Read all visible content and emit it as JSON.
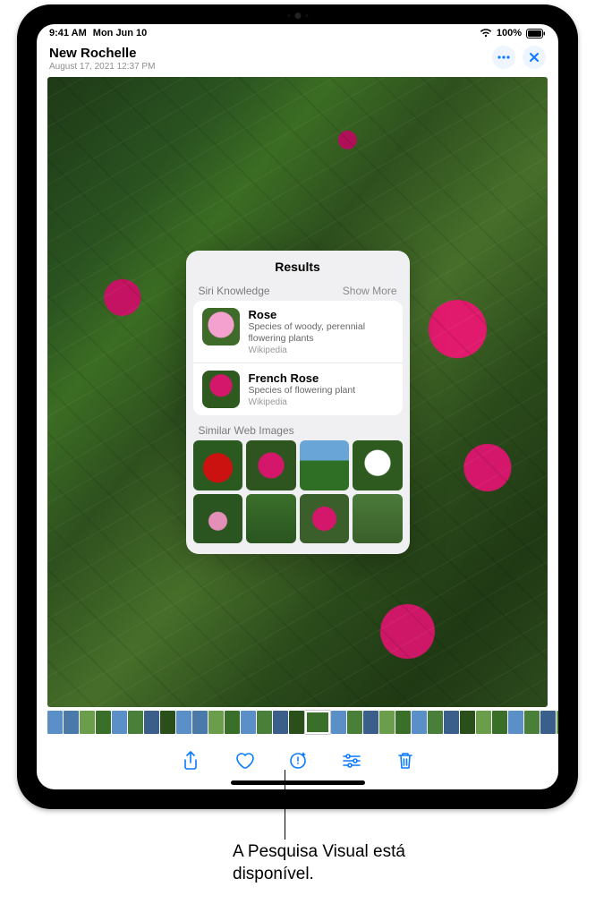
{
  "status": {
    "time": "9:41 AM",
    "date": "Mon Jun 10",
    "battery": "100%"
  },
  "header": {
    "location": "New Rochelle",
    "subtitle": "August 17, 2021  12:37 PM"
  },
  "popover": {
    "title": "Results",
    "siri_knowledge_label": "Siri Knowledge",
    "show_more_label": "Show More",
    "results": [
      {
        "title": "Rose",
        "description": "Species of woody, perennial flowering plants",
        "source": "Wikipedia"
      },
      {
        "title": "French Rose",
        "description": "Species of flowering plant",
        "source": "Wikipedia"
      }
    ],
    "similar_label": "Similar Web Images"
  },
  "callout": {
    "text": "A Pesquisa Visual está disponível."
  },
  "icons": {
    "more": "ellipsis-icon",
    "close": "close-icon",
    "share": "share-icon",
    "favorite": "heart-icon",
    "info": "visual-lookup-icon",
    "edit": "sliders-icon",
    "trash": "trash-icon"
  },
  "similar_colors": [
    "radial-gradient(circle at 50% 55%, #c11 0 16px, #2a5a1f 17px)",
    "radial-gradient(circle at 50% 50%, #d4176a 0 14px, #2e5520 15px)",
    "linear-gradient(#6aa5d8 40%, #2e6f25 40%)",
    "radial-gradient(circle at 50% 45%, #fff 0 14px, #2e5a20 15px)",
    "radial-gradient(circle at 50% 55%, #e38fb8 0 10px, #2a5520 11px)",
    "linear-gradient(#3a6f2a, #2a5520)",
    "radial-gradient(circle at 50% 50%, #d4176a 0 13px, #3a5f2a 14px)",
    "linear-gradient(#4a7a3a, #3a5f2a)"
  ],
  "strip_colors": [
    "#5a8fc8",
    "#4a7aaa",
    "#6b9e4a",
    "#3a6f2a",
    "#5a8fc8",
    "#4a7f3a",
    "#3a5f8a",
    "#2a4f1a",
    "#5a8fc8",
    "#4a7aaa",
    "#6b9e4a",
    "#3a6f2a",
    "#5a8fc8",
    "#4a7f3a",
    "#3a5f8a",
    "#2a4f1a",
    "#3a6f2a",
    "#5a8fc8",
    "#4a7f3a",
    "#3a5f8a",
    "#6b9e4a",
    "#3a6f2a",
    "#5a8fc8",
    "#4a7f3a",
    "#3a5f8a",
    "#2a4f1a",
    "#6b9e4a",
    "#3a6f2a",
    "#5a8fc8",
    "#4a7f3a",
    "#3a5f8a",
    "#6b9e4a"
  ]
}
